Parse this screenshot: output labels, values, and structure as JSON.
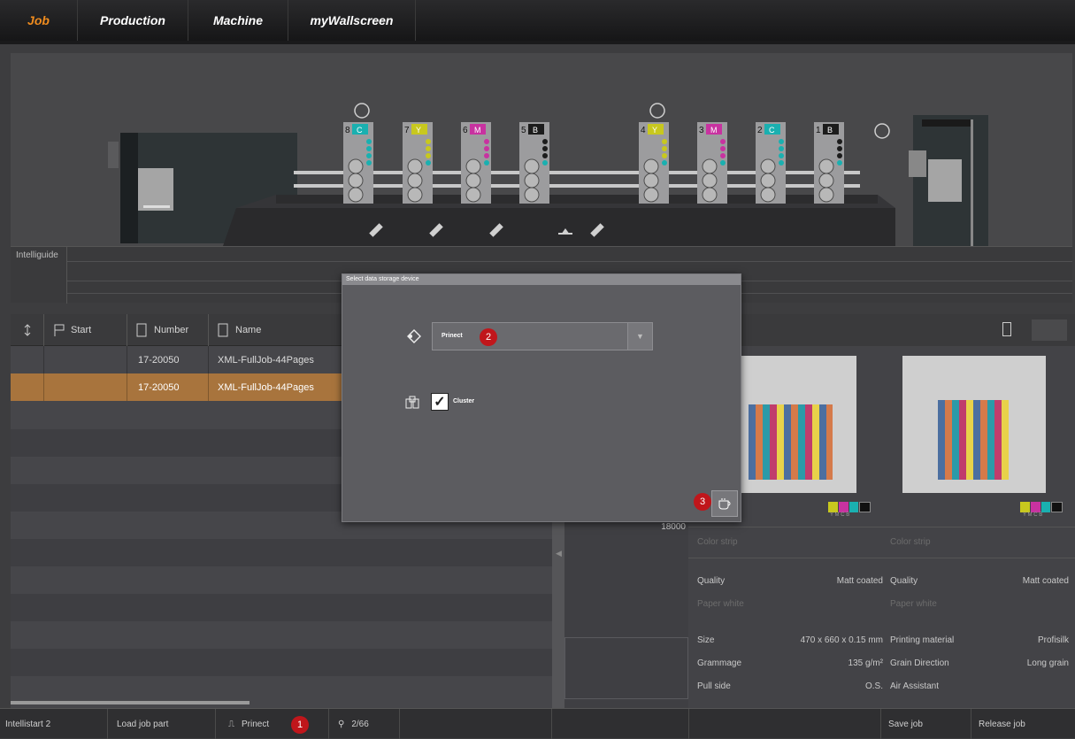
{
  "tabs": [
    {
      "label": "Job",
      "active": true
    },
    {
      "label": "Production",
      "active": false
    },
    {
      "label": "Machine",
      "active": false
    },
    {
      "label": "myWallscreen",
      "active": false
    }
  ],
  "units": [
    {
      "num": "8",
      "color": "C",
      "hex": "#1ab0b0"
    },
    {
      "num": "7",
      "color": "Y",
      "hex": "#c8c81e"
    },
    {
      "num": "6",
      "color": "M",
      "hex": "#c832a0"
    },
    {
      "num": "5",
      "color": "B",
      "hex": "#1c1c1c"
    },
    {
      "num": "4",
      "color": "Y",
      "hex": "#c8c81e"
    },
    {
      "num": "3",
      "color": "M",
      "hex": "#c832a0"
    },
    {
      "num": "2",
      "color": "C",
      "hex": "#1ab0b0"
    },
    {
      "num": "1",
      "color": "B",
      "hex": "#1c1c1c"
    }
  ],
  "intelliguide": {
    "label": "Intelliguide"
  },
  "joblist": {
    "headers": {
      "start": "Start",
      "number": "Number",
      "name": "Name"
    },
    "rows": [
      {
        "number": "17-20050",
        "name": "XML-FullJob-44Pages",
        "selected": false
      },
      {
        "number": "17-20050",
        "name": "XML-FullJob-44Pages",
        "selected": true
      }
    ],
    "value": "18000"
  },
  "colorbar": {
    "labels": "Y M C B"
  },
  "properties": {
    "left": [
      {
        "label": "Color strip",
        "value": "",
        "dim": true
      },
      {
        "label": "Quality",
        "value": "Matt coated",
        "dim": false
      },
      {
        "label": "Paper white",
        "value": "",
        "dim": true
      },
      {
        "label": "Size",
        "value": "470 x 660 x 0.15 mm",
        "dim": false
      },
      {
        "label": "Grammage",
        "value": "135 g/m²",
        "dim": false
      },
      {
        "label": "Pull side",
        "value": "O.S.",
        "dim": false
      }
    ],
    "right": [
      {
        "label": "Color strip",
        "value": "",
        "dim": true
      },
      {
        "label": "Quality",
        "value": "Matt coated",
        "dim": false
      },
      {
        "label": "Paper white",
        "value": "",
        "dim": true
      },
      {
        "label": "Printing material",
        "value": "Profisilk",
        "dim": false
      },
      {
        "label": "Grain Direction",
        "value": "Long grain",
        "dim": false
      },
      {
        "label": "Air Assistant",
        "value": "",
        "dim": false
      }
    ]
  },
  "bottombar": {
    "intellistart": "Intellistart 2",
    "load_job_part": "Load job part",
    "source": "Prinect",
    "filter_count": "2/66",
    "save_job": "Save job",
    "release_job": "Release job"
  },
  "dialog": {
    "title": "Select data storage device",
    "device_value": "Prinect",
    "cluster_label": "Cluster",
    "cluster_checked": true
  },
  "badges": {
    "one": "1",
    "two": "2",
    "three": "3"
  }
}
